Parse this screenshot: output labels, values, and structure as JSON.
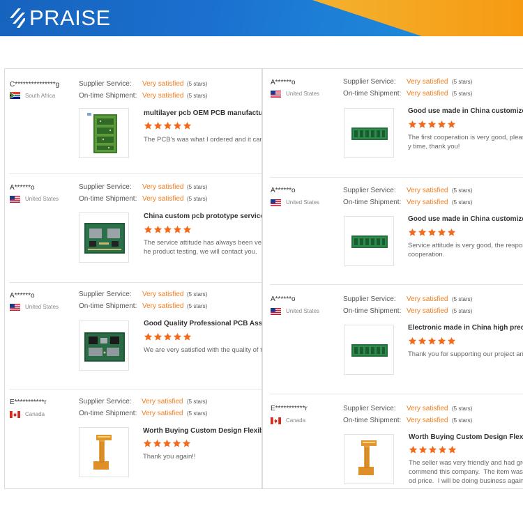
{
  "brand": {
    "name": "PRAISE",
    "blue": "#1b6fce",
    "orange": "#f7a21b"
  },
  "labels": {
    "supplier_service": "Supplier Service:",
    "ontime_shipment": "On-time Shipment:",
    "very_satisfied": "Very satisfied",
    "five_stars": "(5 stars)"
  },
  "colors": {
    "accent": "#f07d1e",
    "star": "#f26b1d"
  },
  "left_reviews": [
    {
      "name": "C***************g",
      "country": "South Africa",
      "flag": "south-africa-flag",
      "product_icon": "pcb-board-tall-icon",
      "rating": 5,
      "title": "multilayer pcb OEM PCB manufacture pcb board",
      "comment": "The PCB's was what I ordered and it came quickly"
    },
    {
      "name": "A******o",
      "country": "United States",
      "flag": "us-flag",
      "product_icon": "pcb-assembly-icon",
      "rating": 5,
      "title": "China custom pcb prototype service supplier",
      "comment": "The service attitude has always been very good\nhe product testing, we will contact you."
    },
    {
      "name": "A******o",
      "country": "United States",
      "flag": "us-flag",
      "product_icon": "pcb-assembly-icon",
      "rating": 5,
      "title": "Good Quality Professional PCB Assembly Service",
      "comment": "We are very satisfied with the quality of the board"
    },
    {
      "name": "E***********r",
      "country": "Canada",
      "flag": "canada-flag",
      "product_icon": "flexible-pcb-icon",
      "rating": 5,
      "title": "Worth Buying Custom Design Flexible Electronic",
      "comment": "Thank you again!!"
    }
  ],
  "right_reviews": [
    {
      "name": "A******o",
      "country": "United States",
      "flag": "us-flag",
      "product_icon": "pcb-strip-icon",
      "rating": 5,
      "title": "Good use made in China customized multilayer",
      "comment": "The first cooperation is very good, pleased with\ny time, thank you!"
    },
    {
      "name": "A******o",
      "country": "United States",
      "flag": "us-flag",
      "product_icon": "pcb-strip-icon",
      "rating": 5,
      "title": "Good use made in China customized multilayer",
      "comment": "Service attitude is very good, the response is fast\ncooperation."
    },
    {
      "name": "A******o",
      "country": "United States",
      "flag": "us-flag",
      "product_icon": "pcb-strip-icon",
      "rating": 5,
      "title": "Electronic made in China high precision pcb",
      "comment": "Thank you for supporting our project and delivery"
    },
    {
      "name": "E***********r",
      "country": "Canada",
      "flag": "canada-flag",
      "product_icon": "flexible-pcb-icon",
      "rating": 5,
      "title": "Worth Buying Custom Design Flexible Electronic",
      "comment": "The seller was very friendly and had great service\ncommend this company.  The item was as described\nod price.  I will be doing business again with them"
    }
  ]
}
